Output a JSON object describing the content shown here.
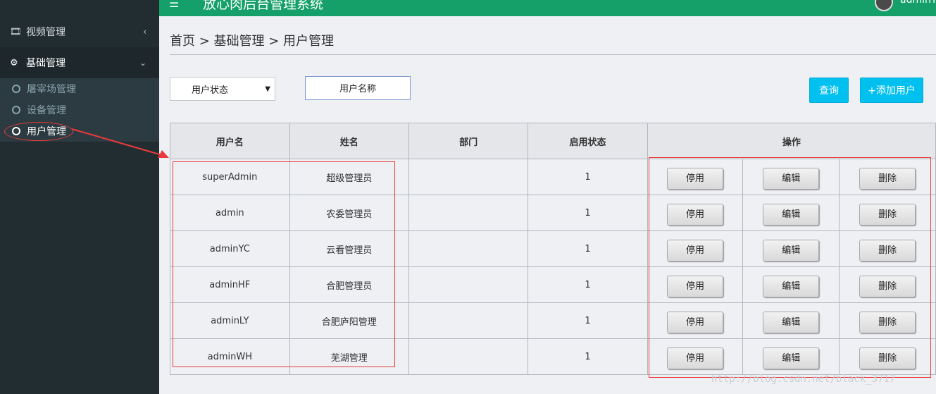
{
  "topbar": {
    "menu_icon": "hamburger-icon",
    "title": "放心肉后台管理系统",
    "user": "adminYC",
    "color": "#14a068"
  },
  "sidebar": {
    "video": {
      "label": "视频管理",
      "icon": "film-icon",
      "arrow": "‹"
    },
    "base": {
      "label": "基础管理",
      "icon": "gear-icon",
      "arrow": "⌄"
    },
    "submenu": [
      {
        "label": "屠宰场管理"
      },
      {
        "label": "设备管理"
      },
      {
        "label": "用户管理",
        "active": true
      }
    ]
  },
  "breadcrumb": "首页 > 基础管理 > 用户管理",
  "filters": {
    "status_select": "用户状态",
    "name_placeholder": "用户名称",
    "query_label": "查询",
    "add_label": "+添加用户"
  },
  "table": {
    "headers": [
      "用户名",
      "姓名",
      "部门",
      "启用状态",
      "操作"
    ],
    "rows": [
      {
        "username": "superAdmin",
        "name": "超级管理员",
        "dept": "",
        "status": "1"
      },
      {
        "username": "admin",
        "name": "农委管理员",
        "dept": "",
        "status": "1"
      },
      {
        "username": "adminYC",
        "name": "云看管理员",
        "dept": "",
        "status": "1"
      },
      {
        "username": "adminHF",
        "name": "合肥管理员",
        "dept": "",
        "status": "1"
      },
      {
        "username": "adminLY",
        "name": "合肥庐阳管理",
        "dept": "",
        "status": "1"
      },
      {
        "username": "adminWH",
        "name": "芜湖管理",
        "dept": "",
        "status": "1"
      }
    ],
    "actions": {
      "disable": "停用",
      "edit": "编辑",
      "delete": "删除"
    }
  },
  "watermark": "http://blog.csdn.net/black_3717"
}
